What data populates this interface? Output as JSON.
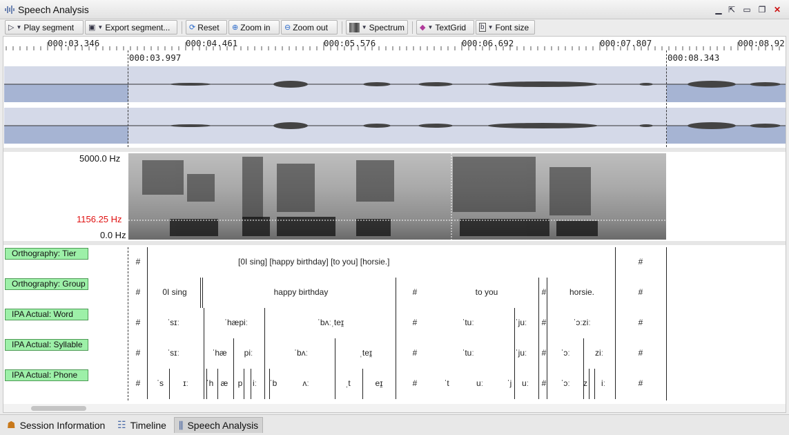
{
  "window": {
    "title": "Speech Analysis"
  },
  "toolbar": {
    "play_segment": "Play segment",
    "export_segment": "Export segment...",
    "reset": "Reset",
    "zoom_in": "Zoom in",
    "zoom_out": "Zoom out",
    "spectrum": "Spectrum",
    "textgrid": "TextGrid",
    "font_size": "Font size"
  },
  "timeline": {
    "ticks": [
      "000:03.346",
      "000:04.461",
      "000:05.576",
      "000:06.692",
      "000:07.807",
      "000:08.92"
    ],
    "selection_start": "000:03.997",
    "selection_end": "000:08.343"
  },
  "spectrogram": {
    "max_freq": "5000.0 Hz",
    "cursor_freq": "1156.25 Hz",
    "min_freq": "0.0 Hz",
    "cursor_color": "#e01010"
  },
  "tiers": {
    "orthography_tier": {
      "label": "Orthography: Tier",
      "cells": [
        "#",
        "[0I sing] [happy birthday] [to you] [horsie.]",
        "#"
      ]
    },
    "orthography_group": {
      "label": "Orthography: Group",
      "cells": [
        "#",
        "0I sing",
        "happy birthday",
        "#",
        "to you",
        "#",
        "horsie.",
        "#"
      ]
    },
    "ipa_word": {
      "label": "IPA Actual: Word",
      "cells": [
        "#",
        "ˈsɪː",
        "ˈhæpiː",
        "ˈbʌːˌteɪ̯",
        "#",
        "ˈtuː",
        "ˈjuː",
        "#",
        "ˈɔːziː",
        "#"
      ]
    },
    "ipa_syllable": {
      "label": "IPA Actual: Syllable",
      "cells": [
        "#",
        "ˈsɪː",
        "ˈhæ",
        "piː",
        "ˈbʌː",
        "ˌteɪ̯",
        "#",
        "ˈtuː",
        "ˈjuː",
        "#",
        "ˈɔː",
        "ziː",
        "#"
      ]
    },
    "ipa_phone": {
      "label": "IPA Actual: Phone",
      "cells": [
        "#",
        "ˈs",
        "ɪː",
        "ˈh",
        "æ",
        "p",
        "iː",
        "ˈb",
        "ʌː",
        "ˌt",
        "eɪ̯",
        "#",
        "ˈt",
        "uː",
        "ˈj",
        "uː",
        "#",
        "ˈɔː",
        "z",
        "iː",
        "#"
      ]
    }
  },
  "bottom_tabs": [
    "Session Information",
    "Timeline",
    "Speech Analysis"
  ],
  "colors": {
    "tier_label_bg": "#9df0a8",
    "wave_selection": "#a6b4d3",
    "wave_bg": "#d4d9e8"
  }
}
